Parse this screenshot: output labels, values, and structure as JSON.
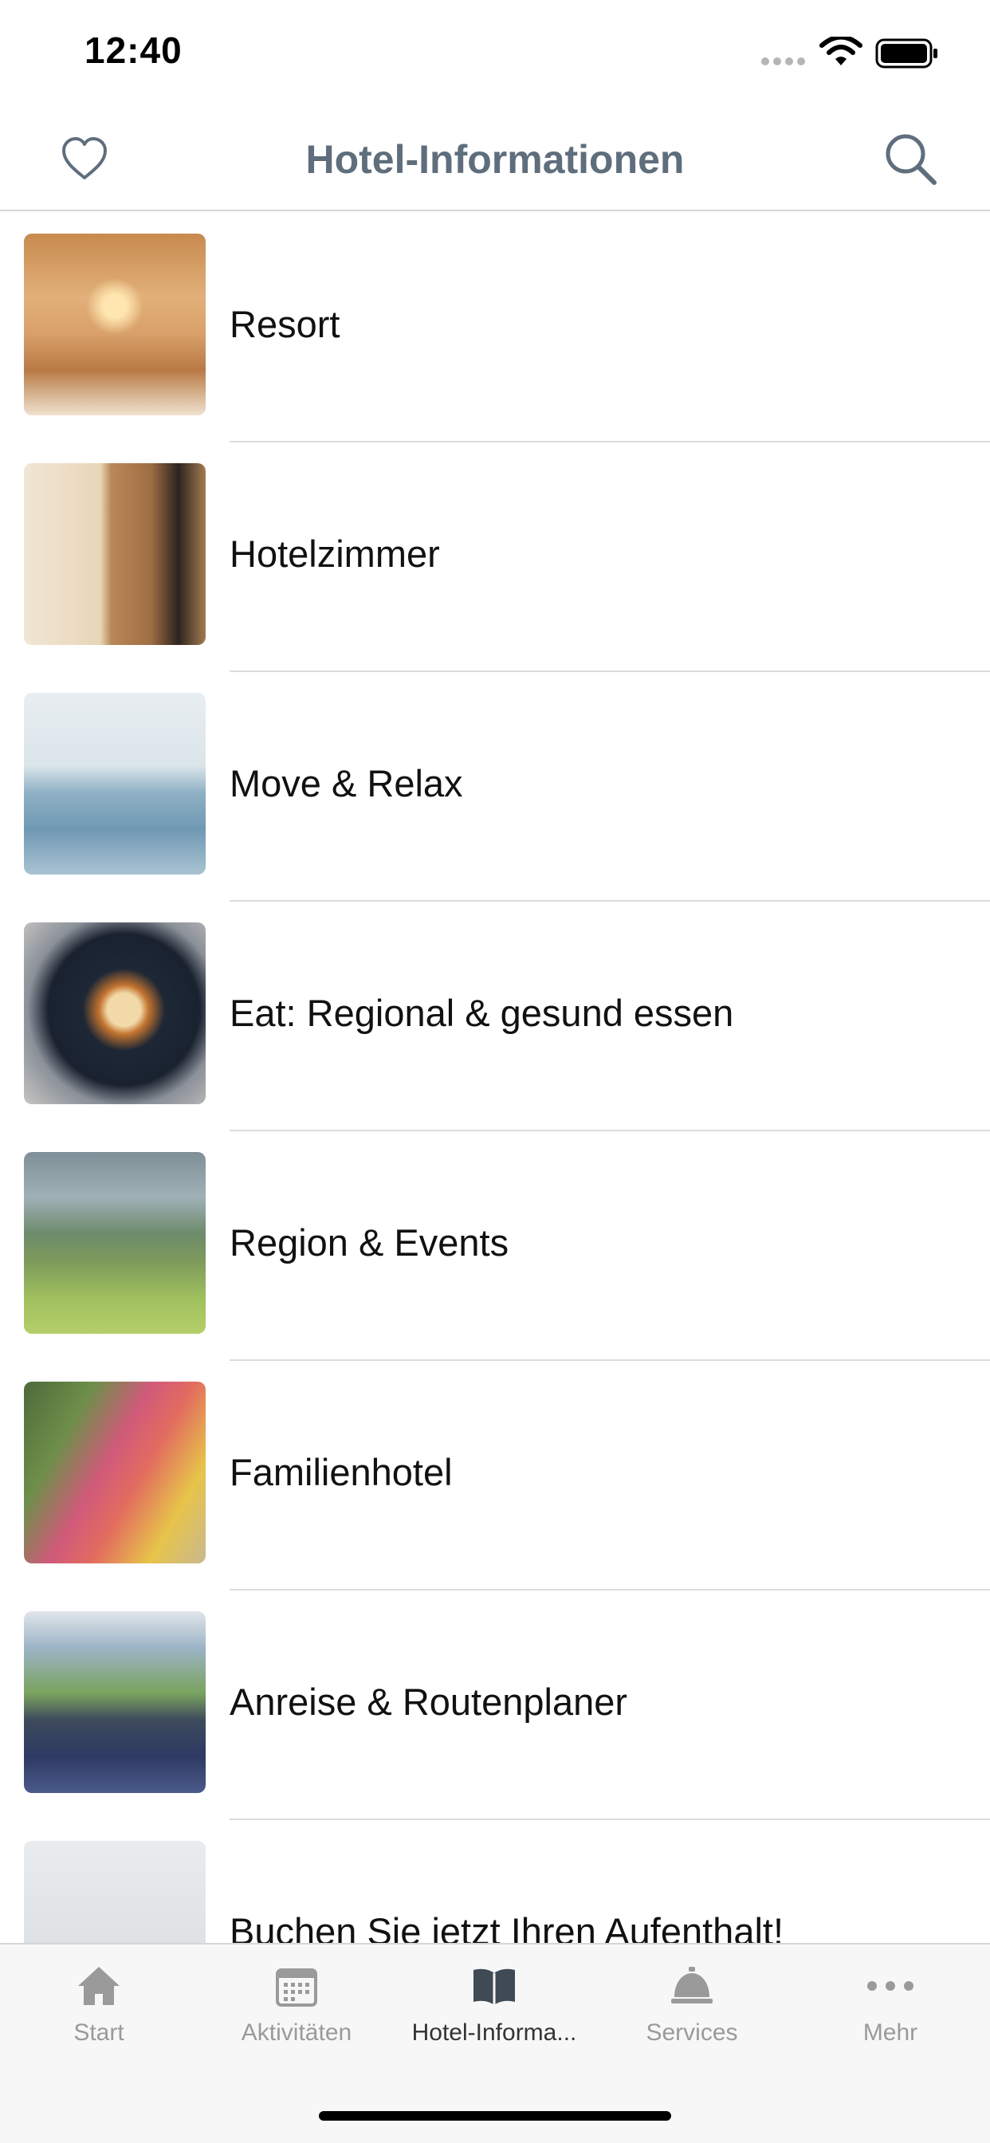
{
  "status_bar": {
    "time": "12:40"
  },
  "header": {
    "title": "Hotel-Informationen"
  },
  "items": [
    {
      "label": "Resort"
    },
    {
      "label": "Hotelzimmer"
    },
    {
      "label": "Move & Relax"
    },
    {
      "label": "Eat: Regional & gesund essen"
    },
    {
      "label": "Region & Events"
    },
    {
      "label": "Familienhotel"
    },
    {
      "label": "Anreise & Routenplaner"
    },
    {
      "label": "Buchen Sie jetzt Ihren Aufenthalt!"
    }
  ],
  "tabs": [
    {
      "label": "Start",
      "icon": "house-icon"
    },
    {
      "label": "Aktivitäten",
      "icon": "calendar-icon"
    },
    {
      "label": "Hotel-Informa...",
      "icon": "book-icon",
      "active": true
    },
    {
      "label": "Services",
      "icon": "service-bell-icon"
    },
    {
      "label": "Mehr",
      "icon": "more-dots-icon"
    }
  ],
  "colors": {
    "nav_title": "#5f6e7d",
    "tab_inactive": "#9a9a9a",
    "tab_active": "#333333"
  }
}
